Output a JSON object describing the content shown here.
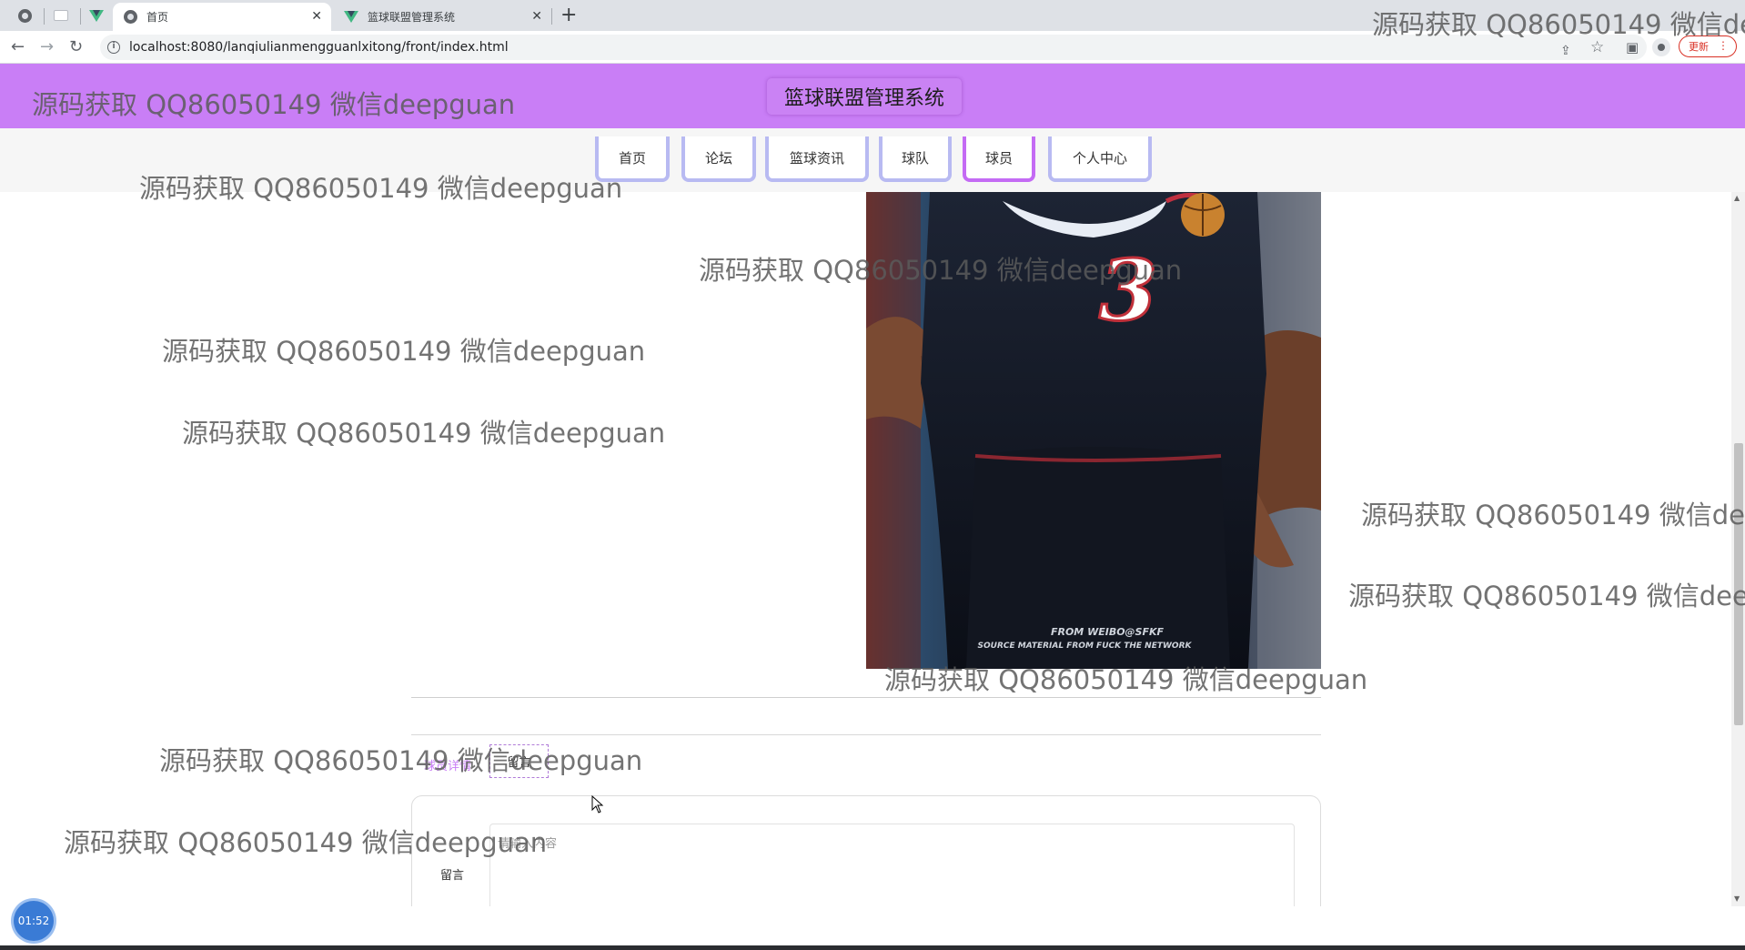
{
  "browser": {
    "tabs": [
      {
        "title": "首页",
        "active": true
      },
      {
        "title": "篮球联盟管理系统",
        "active": false
      }
    ],
    "close_glyph": "✕",
    "new_tab_glyph": "+",
    "url": "localhost:8080/lanqiulianmengguanlxitong/front/index.html",
    "update_button": "更新",
    "menu_glyph": "⋮"
  },
  "site": {
    "title": "篮球联盟管理系统",
    "nav": [
      "首页",
      "论坛",
      "篮球资讯",
      "球队",
      "球员",
      "个人中心"
    ],
    "active_nav": "球员",
    "accent_color": "#c97ef6"
  },
  "detail": {
    "photo": {
      "jersey_number": "3",
      "caption_line1": "FROM WEIBO@SFKF",
      "caption_line2": "SOURCE MATERIAL FROM FUCK THE NETWORK"
    },
    "tabs": [
      "球员详情",
      "留言"
    ],
    "active_tab": "留言",
    "comment_label": "留言",
    "comment_placeholder": "请输入内容"
  },
  "timer": "01:52",
  "watermark_text": "源码获取 QQ86050149 微信deepguan"
}
